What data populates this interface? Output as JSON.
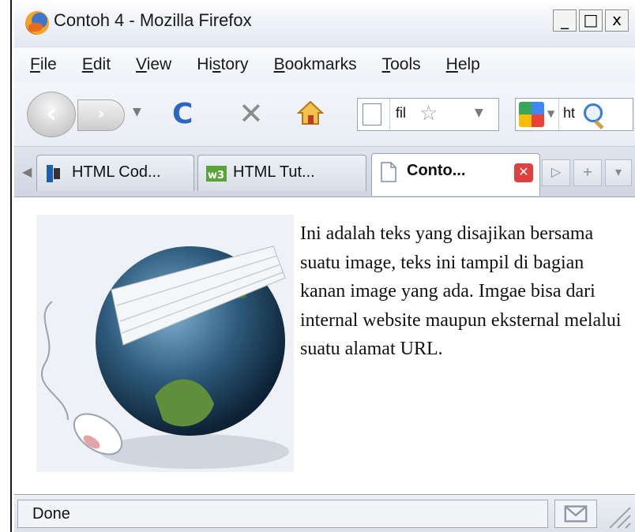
{
  "window": {
    "title": "Contoh 4 - Mozilla Firefox",
    "controls": [
      "_",
      "□",
      "x"
    ]
  },
  "menu": {
    "items": [
      {
        "label": "File",
        "key": "F"
      },
      {
        "label": "Edit",
        "key": "E"
      },
      {
        "label": "View",
        "key": "V"
      },
      {
        "label": "History",
        "key": "s"
      },
      {
        "label": "Bookmarks",
        "key": "B"
      },
      {
        "label": "Tools",
        "key": "T"
      },
      {
        "label": "Help",
        "key": "H"
      }
    ]
  },
  "navbar": {
    "url_text": "fil",
    "search_text": "ht"
  },
  "tabs": [
    {
      "label": "HTML Cod...",
      "icon": "dreamweaver-icon",
      "active": false
    },
    {
      "label": "HTML Tut...",
      "icon": "w3schools-icon",
      "active": false
    },
    {
      "label": "Conto...",
      "icon": "page-icon",
      "active": true
    }
  ],
  "content": {
    "paragraph": "Ini adalah teks yang disajikan bersama suatu image, teks ini tampil di bagian kanan image yang ada. Imgae bisa dari internal website maupun eksternal melalui suatu alamat URL."
  },
  "status": {
    "text": "Done"
  },
  "colors": {
    "accent_blue": "#2a66c2",
    "tab_close_red": "#e04040",
    "chrome_light": "#eef1f7"
  }
}
